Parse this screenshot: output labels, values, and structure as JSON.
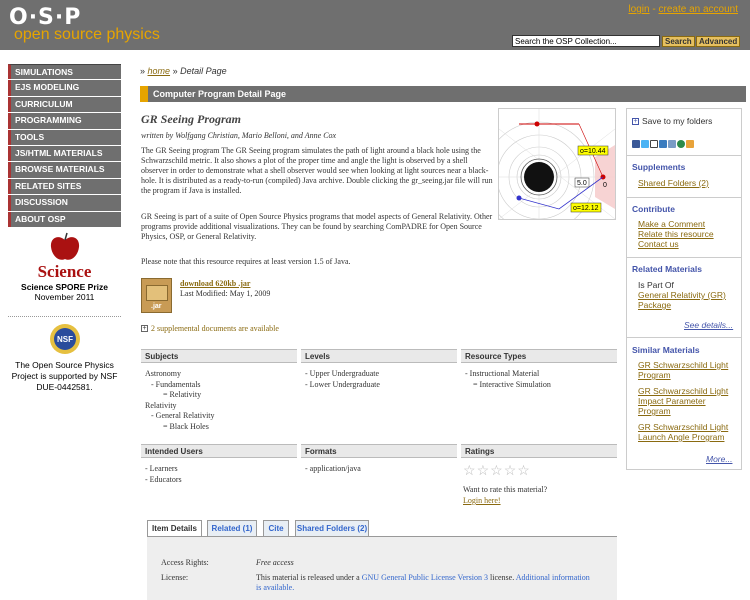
{
  "header": {
    "logo_letters": "O·S·P",
    "logo_text": "open source physics",
    "login_label": "login",
    "separator": "-",
    "create_account_label": "create an account",
    "search_value": "Search the OSP Collection...",
    "search_button": "Search",
    "advanced_button": "Advanced"
  },
  "nav": {
    "items": [
      "SIMULATIONS",
      "EJS MODELING",
      "CURRICULUM",
      "PROGRAMMING",
      "TOOLS",
      "JS/HTML MATERIALS",
      "BROWSE MATERIALS",
      "RELATED SITES",
      "DISCUSSION",
      "ABOUT OSP"
    ]
  },
  "spore": {
    "word": "Science",
    "line1": "Science SPORE Prize",
    "line2": "November 2011"
  },
  "nsf": {
    "badge": "NSF",
    "line1": "The Open Source Physics",
    "line2": "Project is supported by NSF",
    "line3": "DUE-0442581."
  },
  "breadcrumb": {
    "prefix": "»",
    "home": "home",
    "sep": "»",
    "current": "Detail Page"
  },
  "title_bar": "Computer Program Detail Page",
  "resource": {
    "title": "GR Seeing Program",
    "authors": "written by Wolfgang Christian, Mario Belloni, and Anne Cox",
    "para1": "The GR Seeing program The GR Seeing program simulates the path of light around a black hole using the Schwarzschild metric. It also shows a plot of the proper time and angle the light is observed by a shell observer in order to demonstrate what a shell observer would see when looking at light sources near a black-hole.  It is distributed as a ready-to-run (compiled) Java archive.  Double clicking the gr_seeing.jar file will run the program if Java is installed.",
    "para2": "GR Seeing is part of a suite of Open Source Physics programs that model aspects of General Relativity.  Other programs provide additional visualizations.  They can be found by searching ComPADRE for Open Source Physics, OSP, or General Relativity.",
    "para3": "Please note that this resource requires at least version 1.5 of Java.",
    "download": "download 620kb .jar",
    "last_modified": "Last Modified: May 1, 2009",
    "jar_label": ".jar",
    "supp_docs": "2 supplemental documents are available",
    "thumb_labels": {
      "o1": "o=10.44",
      "val": "5.0",
      "o2": "o=12.12",
      "zero": "0"
    }
  },
  "table": {
    "subjects_header": "Subjects",
    "levels_header": "Levels",
    "types_header": "Resource Types",
    "subjects": [
      "Astronomy",
      "- Fundamentals",
      "= Relativity",
      "Relativity",
      "- General Relativity",
      "= Black Holes"
    ],
    "levels": [
      "- Upper Undergraduate",
      "- Lower Undergraduate"
    ],
    "types": [
      "- Instructional Material",
      "= Interactive Simulation"
    ],
    "users_header": "Intended Users",
    "formats_header": "Formats",
    "ratings_header": "Ratings",
    "users": [
      "- Learners",
      "- Educators"
    ],
    "formats": [
      "- application/java"
    ],
    "rating_prompt": "Want to rate this material?",
    "login_here": "Login here!",
    "star_count": 5
  },
  "tabs": [
    "Item Details",
    "Related (1)",
    "Cite",
    "Shared Folders (2)"
  ],
  "details": {
    "access_label": "Access Rights:",
    "access_value": "Free access",
    "license_label": "License:",
    "license_text": "This material is released under a ",
    "license_link": "GNU General Public License Version 3",
    "license_after": " license. ",
    "additional_link": "Additional information is available."
  },
  "sidebar": {
    "save": "Save to my folders",
    "supplements_head": "Supplements",
    "shared_folders": "Shared Folders (2)",
    "contribute_head": "Contribute",
    "contribute_links": [
      "Make a Comment",
      "Relate this resource",
      "Contact us"
    ],
    "related_head": "Related Materials",
    "is_part_of": "Is Part Of",
    "part_link": "General Relativity (GR) Package",
    "see_details": "See details...",
    "similar_head": "Similar Materials",
    "similar": [
      "GR Schwarzschild Light Program",
      "GR Schwarzschild Light Impact Parameter Program",
      "GR Schwarzschild Light Launch Angle Program"
    ],
    "more": "More..."
  },
  "colors": {
    "header_gray": "#6f6f6f",
    "accent_orange": "#e6a400",
    "link_brown": "#8a6a10",
    "sidebar_head": "#4455aa"
  }
}
